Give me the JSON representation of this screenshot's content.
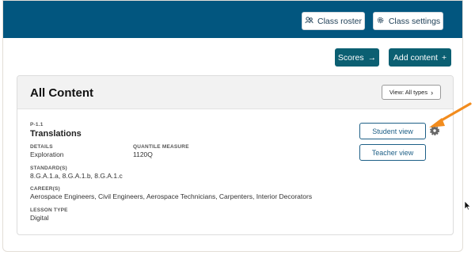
{
  "header": {
    "class_roster_label": "Class roster",
    "class_settings_label": "Class settings"
  },
  "actions": {
    "scores_label": "Scores",
    "add_content_label": "Add content"
  },
  "content": {
    "title": "All Content",
    "filter_label": "View: All types",
    "item": {
      "code": "P-1.1",
      "title": "Translations",
      "details_label": "DETAILS",
      "details_value": "Exploration",
      "quantile_label": "QUANTILE MEASURE",
      "quantile_value": "1120Q",
      "standards_label": "STANDARD(S)",
      "standards_value": "8.G.A.1.a, 8.G.A.1.b, 8.G.A.1.c",
      "careers_label": "CAREER(S)",
      "careers_value": "Aerospace Engineers, Civil Engineers, Aerospace Technicians, Carpenters, Interior Decorators",
      "lesson_type_label": "LESSON TYPE",
      "lesson_type_value": "Digital",
      "student_view_label": "Student view",
      "teacher_view_label": "Teacher view"
    }
  },
  "colors": {
    "banner": "#02567f",
    "teal_button": "#0b5f72",
    "annotation_arrow": "#f28c1e"
  }
}
